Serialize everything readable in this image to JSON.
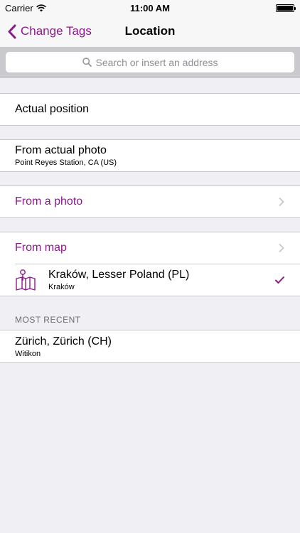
{
  "status_bar": {
    "carrier": "Carrier",
    "time": "11:00 AM"
  },
  "nav": {
    "back_label": "Change Tags",
    "title": "Location"
  },
  "search": {
    "placeholder": "Search or insert an address"
  },
  "rows": {
    "actual_position": {
      "title": "Actual position"
    },
    "actual_photo": {
      "title": "From actual photo",
      "subtitle": "Point Reyes Station, CA (US)"
    },
    "from_photo": {
      "title": "From a photo"
    },
    "from_map": {
      "title": "From map"
    },
    "selected_location": {
      "title": "Kraków, Lesser Poland (PL)",
      "subtitle": "Kraków"
    }
  },
  "most_recent": {
    "header": "MOST RECENT",
    "items": [
      {
        "title": "Zürich, Zürich (CH)",
        "subtitle": "Witikon"
      }
    ]
  },
  "colors": {
    "accent": "#8b1a8a",
    "background": "#efeff4"
  },
  "icons": [
    "wifi-icon",
    "battery-icon",
    "back-chevron-icon",
    "search-icon",
    "chevron-right-icon",
    "map-pin-icon",
    "checkmark-icon"
  ]
}
